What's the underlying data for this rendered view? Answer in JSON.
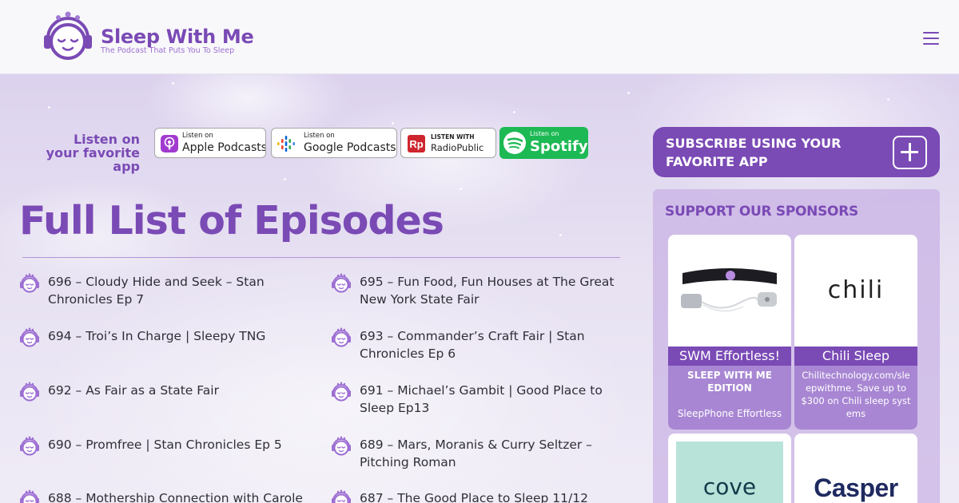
{
  "header": {
    "logo_name": "Sleep With Me",
    "logo_tagline": "The Podcast That Puts You To Sleep",
    "menu_icon": "hamburger-menu-icon"
  },
  "listen": {
    "label_line1": "Listen on",
    "label_line2": "your favorite app",
    "badges": [
      {
        "small": "Listen on",
        "big": "Apple Podcasts"
      },
      {
        "small": "Listen on",
        "big": "Google Podcasts"
      },
      {
        "small": "LISTEN WITH",
        "big": "RadioPublic"
      },
      {
        "small": "Listen on",
        "big": "Spotify"
      }
    ]
  },
  "main": {
    "title": "Full List of Episodes",
    "episodes": [
      "696 – Cloudy Hide and Seek – Stan Chronicles Ep 7",
      "695 – Fun Food, Fun Houses at The Great New York State Fair",
      "694 – Troi’s In Charge | Sleepy TNG",
      "693 – Commander’s Craft Fair | Stan Chronicles Ep 6",
      "692 – As Fair as a State Fair",
      "691 – Michael’s Gambit | Good Place to Sleep Ep13",
      "690 – Promfree | Stan Chronicles Ep 5",
      "689 – Mars, Moranis & Curry Seltzer – Pitching Roman",
      "688 – Mothership Connection with Carole",
      "687 – The Good Place to Sleep 11/12"
    ]
  },
  "sidebar": {
    "subscribe_label": "SUBSCRIBE USING YOUR FAVORITE APP",
    "sponsors_title": "SUPPORT OUR SPONSORS",
    "sponsors": [
      {
        "name": "SWM Effortless!",
        "line1": "SLEEP WITH ME EDITION",
        "line2": "SleepPhone Effortless"
      },
      {
        "name": "Chili Sleep",
        "logo": "chili",
        "desc": "Chilitechnology.com/sleepwithme. Save up to $300 on Chili sleep systems"
      },
      {
        "logo": "cove"
      },
      {
        "logo": "Casper"
      }
    ]
  },
  "colors": {
    "brand_purple": "#7a4ab5",
    "sponsor_panel": "#c4aae2",
    "cove_teal": "#b8e3d9",
    "casper_navy": "#1f2a60"
  }
}
